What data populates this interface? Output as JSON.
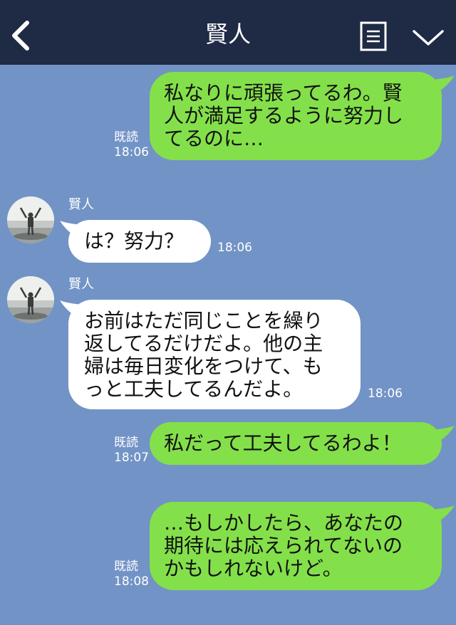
{
  "header": {
    "title": "賢人"
  },
  "icons": {
    "back": "chevron-left-icon",
    "note": "note-icon",
    "menu": "chevron-down-icon"
  },
  "colors": {
    "header_bg": "#1f2a44",
    "chat_bg": "#7293c6",
    "sent_bubble": "#84e04a",
    "received_bubble": "#ffffff"
  },
  "messages": [
    {
      "direction": "sent",
      "text": "私なりに頑張ってるわ。賢\n人が満足するように努力し\nてるのに…",
      "read_label": "既読",
      "time": "18:06"
    },
    {
      "direction": "received",
      "sender": "賢人",
      "text": "は？努力？",
      "time": "18:06"
    },
    {
      "direction": "received",
      "sender": "賢人",
      "text": "お前はただ同じことを繰り\n返してるだけだよ。他の主\n婦は毎日変化をつけて、も\nっと工夫してるんだよ。",
      "time": "18:06"
    },
    {
      "direction": "sent",
      "text": "私だって工夫してるわよ！",
      "read_label": "既読",
      "time": "18:07"
    },
    {
      "direction": "sent",
      "text": "…もしかしたら、あなたの\n期待には応えられてないの\nかもしれないけど。",
      "read_label": "既読",
      "time": "18:08"
    }
  ]
}
